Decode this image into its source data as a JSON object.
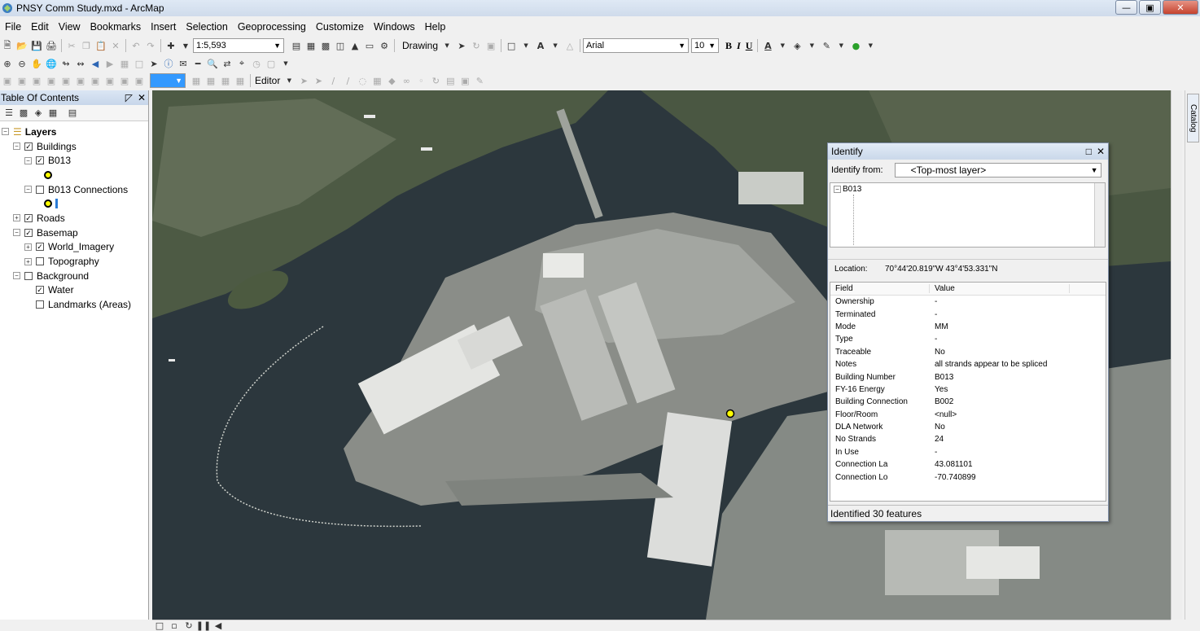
{
  "window": {
    "title": "PNSY Comm Study.mxd - ArcMap"
  },
  "menu": [
    "File",
    "Edit",
    "View",
    "Bookmarks",
    "Insert",
    "Selection",
    "Geoprocessing",
    "Customize",
    "Windows",
    "Help"
  ],
  "toolbar": {
    "scale": "1:5,593",
    "drawing_label": "Drawing",
    "font_name": "Arial",
    "font_size": "10",
    "bold": "B",
    "italic": "I",
    "underline": "U",
    "editor_label": "Editor"
  },
  "toc": {
    "title": "Table Of Contents",
    "layers_label": "Layers",
    "items": [
      {
        "label": "Buildings",
        "checked": true
      },
      {
        "label": "B013",
        "checked": true
      },
      {
        "label": "B013 Connections",
        "checked": false
      },
      {
        "label": "Roads",
        "checked": true
      },
      {
        "label": "Basemap",
        "checked": true
      },
      {
        "label": "World_Imagery",
        "checked": true
      },
      {
        "label": "Topography",
        "checked": false
      },
      {
        "label": "Background",
        "checked": false
      },
      {
        "label": "Water",
        "checked": true
      },
      {
        "label": "Landmarks (Areas)",
        "checked": false
      }
    ]
  },
  "catalog_tab": "Catalog",
  "identify": {
    "title": "Identify",
    "from_label": "Identify from:",
    "from_value": "<Top-most layer>",
    "tree_root": "B013",
    "location_label": "Location:",
    "location_value": "70°44'20.819\"W  43°4'53.331\"N",
    "col_field": "Field",
    "col_value": "Value",
    "rows": [
      {
        "field": "Ownership",
        "value": "-"
      },
      {
        "field": "Terminated",
        "value": "-"
      },
      {
        "field": "Mode",
        "value": "MM"
      },
      {
        "field": "Type",
        "value": "-"
      },
      {
        "field": "Traceable",
        "value": "No"
      },
      {
        "field": "Notes",
        "value": "all strands appear to be spliced"
      },
      {
        "field": "Building Number",
        "value": "B013"
      },
      {
        "field": "FY-16 Energy",
        "value": "Yes"
      },
      {
        "field": "Building Connection",
        "value": "B002"
      },
      {
        "field": "Floor/Room",
        "value": "<null>"
      },
      {
        "field": "DLA Network",
        "value": "No"
      },
      {
        "field": "No Strands",
        "value": "24"
      },
      {
        "field": "In Use",
        "value": "-"
      },
      {
        "field": "Connection La",
        "value": "43.081101"
      },
      {
        "field": "Connection Lo",
        "value": "-70.740899"
      }
    ],
    "status": "Identified 30 features"
  },
  "colors": {
    "point_symbol": "#ffff00",
    "water": "#2f3a40"
  }
}
